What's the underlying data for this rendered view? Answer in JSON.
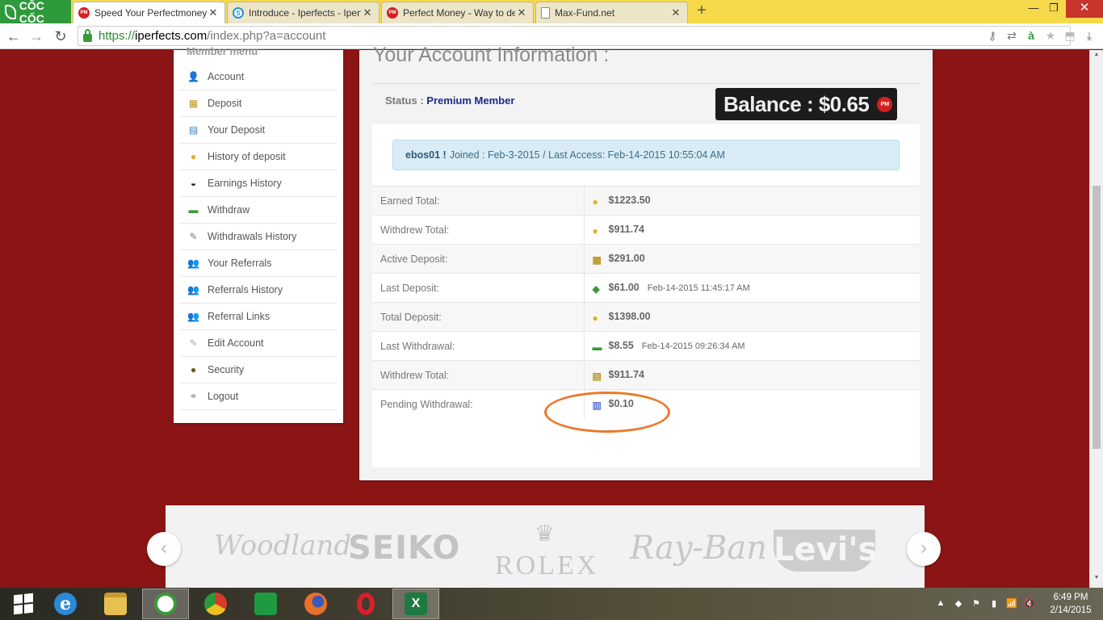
{
  "browser": {
    "brand": "CỐC CỐC",
    "tabs": [
      {
        "title": "Speed Your Perfectmoney",
        "icon": "perfect-money-icon",
        "active": true
      },
      {
        "title": "Introduce - Iperfects - Iperfe",
        "icon": "iperfects-icon",
        "active": false
      },
      {
        "title": "Perfect Money - Way to de",
        "icon": "perfect-money-icon",
        "active": false
      },
      {
        "title": "Max-Fund.net",
        "icon": "document-icon",
        "active": false
      }
    ],
    "url": {
      "scheme": "https://",
      "host": "iperfects.com",
      "path": "/index.php?a=account"
    }
  },
  "sidebar": {
    "title": "Member menu",
    "items": [
      {
        "label": "Account",
        "icon": "user-icon"
      },
      {
        "label": "Deposit",
        "icon": "deposit-icon"
      },
      {
        "label": "Your Deposit",
        "icon": "calculator-icon"
      },
      {
        "label": "History of deposit",
        "icon": "coins-icon"
      },
      {
        "label": "Earnings History",
        "icon": "glasses-icon"
      },
      {
        "label": "Withdraw",
        "icon": "cash-icon"
      },
      {
        "label": "Withdrawals History",
        "icon": "notepad-icon"
      },
      {
        "label": "Your Referrals",
        "icon": "users-icon"
      },
      {
        "label": "Referrals History",
        "icon": "users-history-icon"
      },
      {
        "label": "Referral Links",
        "icon": "users-link-icon"
      },
      {
        "label": "Edit Account",
        "icon": "edit-icon"
      },
      {
        "label": "Security",
        "icon": "security-icon"
      },
      {
        "label": "Logout",
        "icon": "link-icon"
      }
    ]
  },
  "account": {
    "title": "Your Account Information :",
    "status_label": "Status :",
    "status_value": "Premium Member",
    "balance": "Balance : $0.65",
    "balance_badge": "PM",
    "welcome_user": "ebos01 !",
    "welcome_text": "Joined : Feb-3-2015 / Last Access: Feb-14-2015 10:55:04 AM",
    "stats": [
      {
        "label": "Earned Total:",
        "value": "$1223.50",
        "date": "",
        "icon": "coins-icon"
      },
      {
        "label": "Withdrew Total:",
        "value": "$911.74",
        "date": "",
        "icon": "coins-icon"
      },
      {
        "label": "Active Deposit:",
        "value": "$291.00",
        "date": "",
        "icon": "deposit-icon"
      },
      {
        "label": "Last Deposit:",
        "value": "$61.00",
        "date": "Feb-14-2015 11:45:17 AM",
        "icon": "money-icon"
      },
      {
        "label": "Total Deposit:",
        "value": "$1398.00",
        "date": "",
        "icon": "coins-icon"
      },
      {
        "label": "Last Withdrawal:",
        "value": "$8.55",
        "date": "Feb-14-2015 09:26:34 AM",
        "icon": "cash-icon"
      },
      {
        "label": "Withdrew Total:",
        "value": "$911.74",
        "date": "",
        "icon": "calculator-icon"
      },
      {
        "label": "Pending Withdrawal:",
        "value": "$0.10",
        "date": "",
        "icon": "bar-chart-icon"
      }
    ]
  },
  "brands": [
    "Woodland",
    "SEIKO",
    "ROLEX",
    "Ray-Ban",
    "Levi's"
  ],
  "taskbar": {
    "time": "6:49 PM",
    "date": "2/14/2015"
  }
}
